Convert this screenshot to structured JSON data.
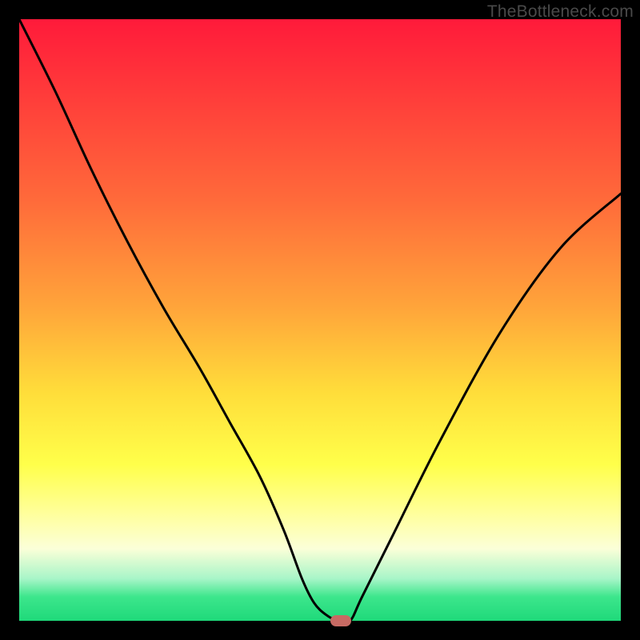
{
  "watermark": "TheBottleneck.com",
  "chart_data": {
    "type": "line",
    "title": "",
    "xlabel": "",
    "ylabel": "",
    "xlim": [
      0,
      100
    ],
    "ylim": [
      0,
      100
    ],
    "grid": false,
    "series": [
      {
        "name": "bottleneck-curve",
        "x": [
          0,
          6,
          12,
          18,
          24,
          30,
          35,
          40,
          44,
          47,
          49,
          51,
          53,
          55,
          57,
          62,
          70,
          80,
          90,
          100
        ],
        "values": [
          100,
          88,
          75,
          63,
          52,
          42,
          33,
          24,
          15,
          7,
          3,
          1,
          0,
          0,
          4,
          14,
          30,
          48,
          62,
          71
        ]
      }
    ],
    "marker": {
      "x": 53.5,
      "y": 0
    },
    "background_gradient": {
      "top_color": "#ff1a3a",
      "bottom_color": "#1fd97a"
    }
  }
}
